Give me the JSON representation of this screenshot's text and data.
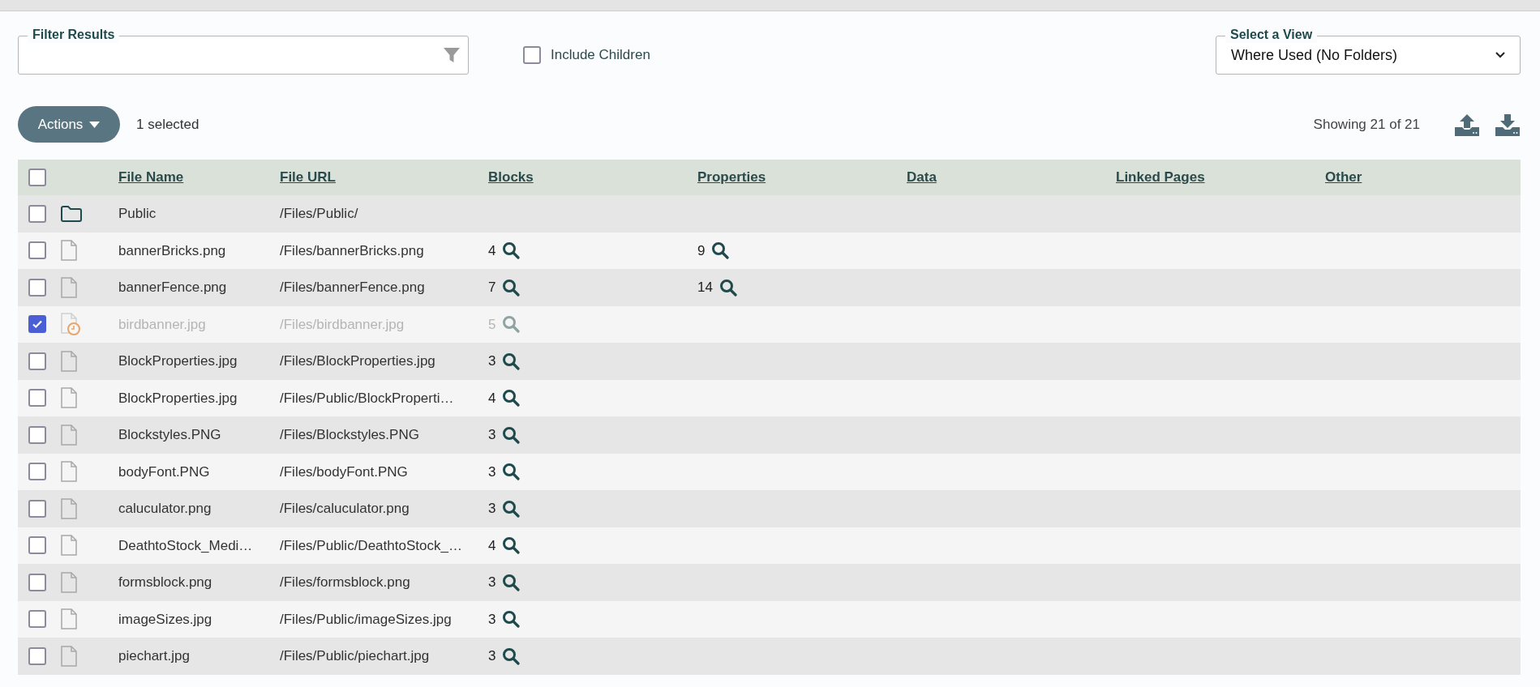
{
  "filter": {
    "label": "Filter Results"
  },
  "include_children": {
    "label": "Include Children",
    "checked": false
  },
  "view_select": {
    "label": "Select a View",
    "value": "Where Used (No Folders)"
  },
  "actions_button": "Actions",
  "selection_count": "1 selected",
  "showing": "Showing 21 of 21",
  "table": {
    "header_checked": false,
    "columns": [
      "File Name",
      "File URL",
      "Blocks",
      "Properties",
      "Data",
      "Linked Pages",
      "Other"
    ],
    "rows": [
      {
        "kind": "folder",
        "checked": false,
        "disabled": false,
        "name": "Public",
        "url": "/Files/Public/"
      },
      {
        "kind": "file",
        "checked": false,
        "disabled": false,
        "name": "bannerBricks.png",
        "url": "/Files/bannerBricks.png",
        "blocks": "4",
        "properties": "9"
      },
      {
        "kind": "file",
        "checked": false,
        "disabled": false,
        "name": "bannerFence.png",
        "url": "/Files/bannerFence.png",
        "blocks": "7",
        "properties": "14"
      },
      {
        "kind": "pending",
        "checked": true,
        "disabled": true,
        "name": "birdbanner.jpg",
        "url": "/Files/birdbanner.jpg",
        "blocks": "5"
      },
      {
        "kind": "file",
        "checked": false,
        "disabled": false,
        "name": "BlockProperties.jpg",
        "url": "/Files/BlockProperties.jpg",
        "blocks": "3"
      },
      {
        "kind": "file",
        "checked": false,
        "disabled": false,
        "name": "BlockProperties.jpg",
        "url": "/Files/Public/BlockProperti…",
        "blocks": "4"
      },
      {
        "kind": "file",
        "checked": false,
        "disabled": false,
        "name": "Blockstyles.PNG",
        "url": "/Files/Blockstyles.PNG",
        "blocks": "3"
      },
      {
        "kind": "file",
        "checked": false,
        "disabled": false,
        "name": "bodyFont.PNG",
        "url": "/Files/bodyFont.PNG",
        "blocks": "3"
      },
      {
        "kind": "file",
        "checked": false,
        "disabled": false,
        "name": "caluculator.png",
        "url": "/Files/caluculator.png",
        "blocks": "3"
      },
      {
        "kind": "file",
        "checked": false,
        "disabled": false,
        "name": "DeathtoStock_Medi…",
        "url": "/Files/Public/DeathtoStock_…",
        "blocks": "4"
      },
      {
        "kind": "file",
        "checked": false,
        "disabled": false,
        "name": "formsblock.png",
        "url": "/Files/formsblock.png",
        "blocks": "3"
      },
      {
        "kind": "file",
        "checked": false,
        "disabled": false,
        "name": "imageSizes.jpg",
        "url": "/Files/Public/imageSizes.jpg",
        "blocks": "3"
      },
      {
        "kind": "file",
        "checked": false,
        "disabled": false,
        "name": "piechart.jpg",
        "url": "/Files/Public/piechart.jpg",
        "blocks": "3"
      }
    ]
  }
}
